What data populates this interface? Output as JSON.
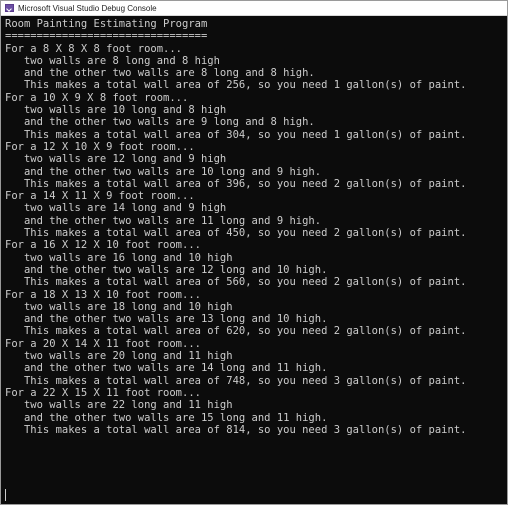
{
  "window": {
    "title": "Microsoft Visual Studio Debug Console",
    "icon": "console-app-icon",
    "colors": {
      "background": "#0c0c0c",
      "text": "#cccccc",
      "titlebar": "#ffffff"
    }
  },
  "console": {
    "lines": [
      "Room Painting Estimating Program",
      "================================",
      "For a 8 X 8 X 8 foot room...",
      "   two walls are 8 long and 8 high",
      "   and the other two walls are 8 long and 8 high.",
      "   This makes a total wall area of 256, so you need 1 gallon(s) of paint.",
      "For a 10 X 9 X 8 foot room...",
      "   two walls are 10 long and 8 high",
      "   and the other two walls are 9 long and 8 high.",
      "   This makes a total wall area of 304, so you need 1 gallon(s) of paint.",
      "For a 12 X 10 X 9 foot room...",
      "   two walls are 12 long and 9 high",
      "   and the other two walls are 10 long and 9 high.",
      "   This makes a total wall area of 396, so you need 2 gallon(s) of paint.",
      "For a 14 X 11 X 9 foot room...",
      "   two walls are 14 long and 9 high",
      "   and the other two walls are 11 long and 9 high.",
      "   This makes a total wall area of 450, so you need 2 gallon(s) of paint.",
      "For a 16 X 12 X 10 foot room...",
      "   two walls are 16 long and 10 high",
      "   and the other two walls are 12 long and 10 high.",
      "   This makes a total wall area of 560, so you need 2 gallon(s) of paint.",
      "For a 18 X 13 X 10 foot room...",
      "   two walls are 18 long and 10 high",
      "   and the other two walls are 13 long and 10 high.",
      "   This makes a total wall area of 620, so you need 2 gallon(s) of paint.",
      "For a 20 X 14 X 11 foot room...",
      "   two walls are 20 long and 11 high",
      "   and the other two walls are 14 long and 11 high.",
      "   This makes a total wall area of 748, so you need 3 gallon(s) of paint.",
      "For a 22 X 15 X 11 foot room...",
      "   two walls are 22 long and 11 high",
      "   and the other two walls are 15 long and 11 high.",
      "   This makes a total wall area of 814, so you need 3 gallon(s) of paint."
    ]
  }
}
